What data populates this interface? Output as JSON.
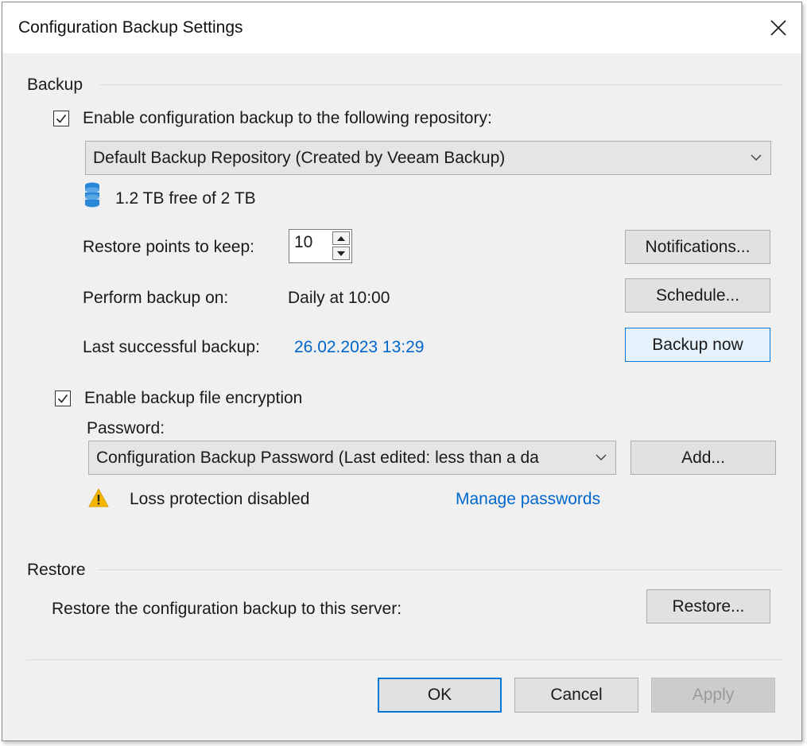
{
  "window": {
    "title": "Configuration Backup Settings"
  },
  "backup": {
    "section_label": "Backup",
    "enable_label": "Enable configuration backup to the following repository:",
    "enable_checked": true,
    "repository": "Default Backup Repository (Created by Veeam Backup)",
    "storage_text": "1.2 TB free of 2 TB",
    "restore_points_label": "Restore points to keep:",
    "restore_points_value": "10",
    "notifications_button": "Notifications...",
    "perform_label": "Perform backup on:",
    "perform_value": "Daily at 10:00",
    "schedule_button": "Schedule...",
    "last_label": "Last successful backup:",
    "last_value": "26.02.2023 13:29",
    "backup_now_button": "Backup now",
    "encryption_label": "Enable backup file encryption",
    "encryption_checked": true,
    "password_label": "Password:",
    "password_value": "Configuration Backup Password (Last edited: less than a da",
    "add_button": "Add...",
    "warning_text": "Loss protection disabled",
    "manage_link": "Manage passwords"
  },
  "restore": {
    "section_label": "Restore",
    "description": "Restore the configuration backup to this server:",
    "restore_button": "Restore..."
  },
  "footer": {
    "ok_button": "OK",
    "cancel_button": "Cancel",
    "apply_button": "Apply"
  },
  "colors": {
    "accent": "#0078d7",
    "link": "#0066cc",
    "warning": "#f2b600",
    "db_icon": "#2b88d8"
  }
}
